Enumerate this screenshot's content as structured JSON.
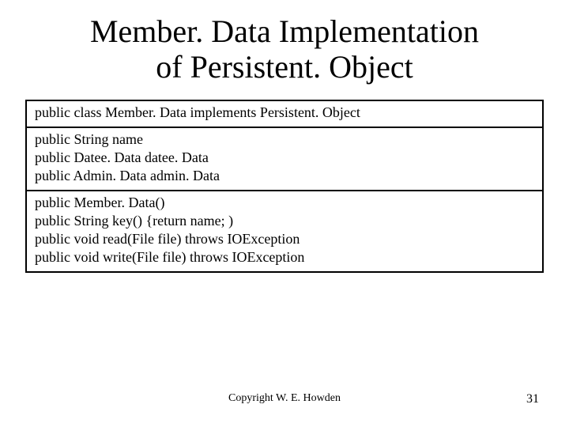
{
  "title_line1": "Member. Data Implementation",
  "title_line2": "of Persistent. Object",
  "compartment1": {
    "line1": "public class Member. Data implements Persistent. Object"
  },
  "compartment2": {
    "line1": "public String name",
    "line2": "public Datee. Data datee. Data",
    "line3": "public Admin. Data admin. Data"
  },
  "compartment3": {
    "line1": "public Member. Data()",
    "line2": "public String key() {return name; )",
    "line3": "public void read(File file) throws IOException",
    "line4": "public void write(File file) throws IOException"
  },
  "footer": {
    "copyright": "Copyright W. E. Howden",
    "page_number": "31"
  }
}
